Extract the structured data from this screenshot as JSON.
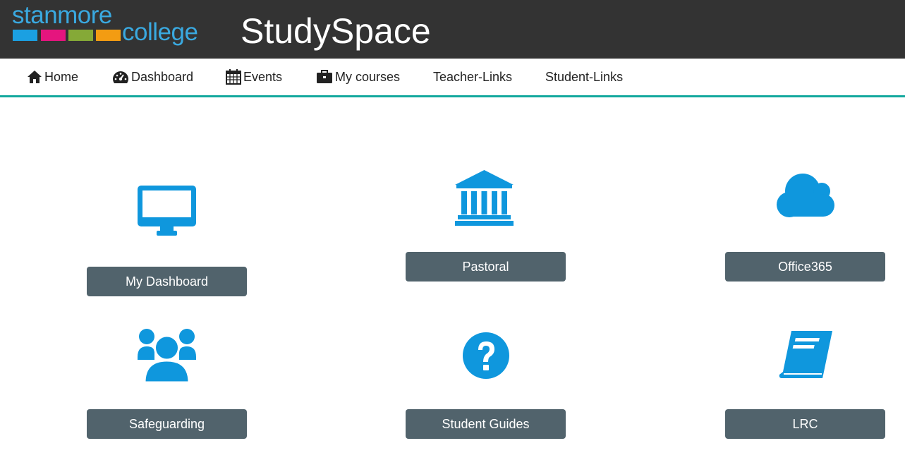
{
  "header": {
    "logo_top": "stanmore",
    "logo_bottom": "college",
    "logo_swatch_colors": [
      "#1ba0e2",
      "#e5157e",
      "#85a937",
      "#f39c12"
    ],
    "app_title": "StudySpace",
    "background_color": "#333333"
  },
  "nav": {
    "items": [
      {
        "label": "Home",
        "icon": "home-icon"
      },
      {
        "label": "Dashboard",
        "icon": "dashboard-icon"
      },
      {
        "label": "Events",
        "icon": "calendar-icon"
      },
      {
        "label": "My courses",
        "icon": "briefcase-icon"
      },
      {
        "label": "Teacher-Links"
      },
      {
        "label": "Student-Links"
      }
    ],
    "underline_color": "#13a89e"
  },
  "tiles": [
    {
      "label": "My Dashboard",
      "icon": "monitor-icon"
    },
    {
      "label": "Pastoral",
      "icon": "bank-icon"
    },
    {
      "label": "Office365",
      "icon": "cloud-icon"
    },
    {
      "label": "Safeguarding",
      "icon": "users-icon"
    },
    {
      "label": "Student Guides",
      "icon": "question-circle-icon"
    },
    {
      "label": "LRC",
      "icon": "book-icon"
    }
  ],
  "colors": {
    "icon_blue": "#0f97dd",
    "button_bg": "#51636c",
    "button_text": "#ffffff"
  }
}
